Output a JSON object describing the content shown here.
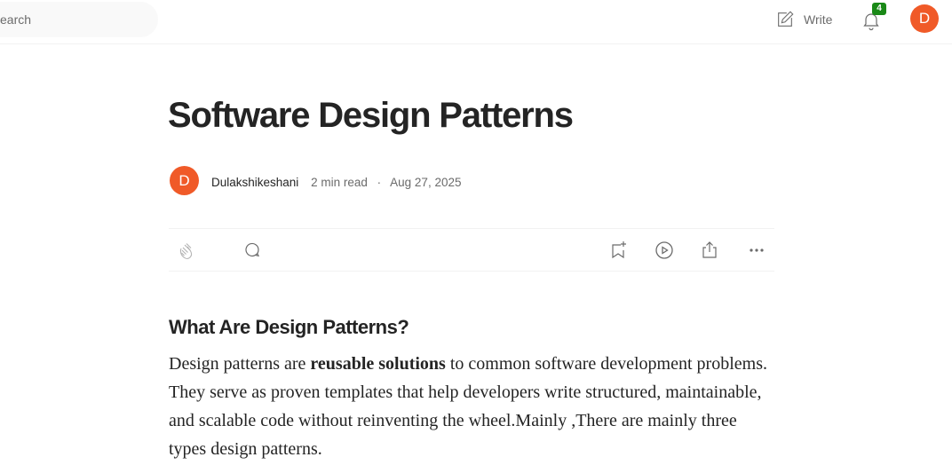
{
  "header": {
    "search_placeholder": "Search",
    "search_visible_text": "earch",
    "write_label": "Write",
    "notification_count": "4",
    "user_initial": "D"
  },
  "article": {
    "title": "Software Design Patterns",
    "author": {
      "initial": "D",
      "name": "Dulakshikeshani"
    },
    "read_time": "2 min read",
    "separator": "·",
    "date": "Aug 27, 2025",
    "section_heading": "What Are Design Patterns?",
    "paragraph": {
      "part1": "Design patterns are ",
      "bold": "reusable solutions",
      "part2": " to common software development problems. They serve as proven templates that help developers write structured, maintainable, and scalable code without reinventing the wheel.Mainly ,There are mainly three types design patterns."
    }
  },
  "icons": {
    "write": "write-icon",
    "notifications": "bell-icon",
    "clap": "clap-icon",
    "comment": "comment-icon",
    "bookmark": "bookmark-add-icon",
    "listen": "play-icon",
    "share": "share-icon",
    "more": "more-icon"
  },
  "colors": {
    "avatar": "#f05a28",
    "badge": "#1a8917",
    "text": "#242424",
    "muted": "#6b6b6b"
  }
}
